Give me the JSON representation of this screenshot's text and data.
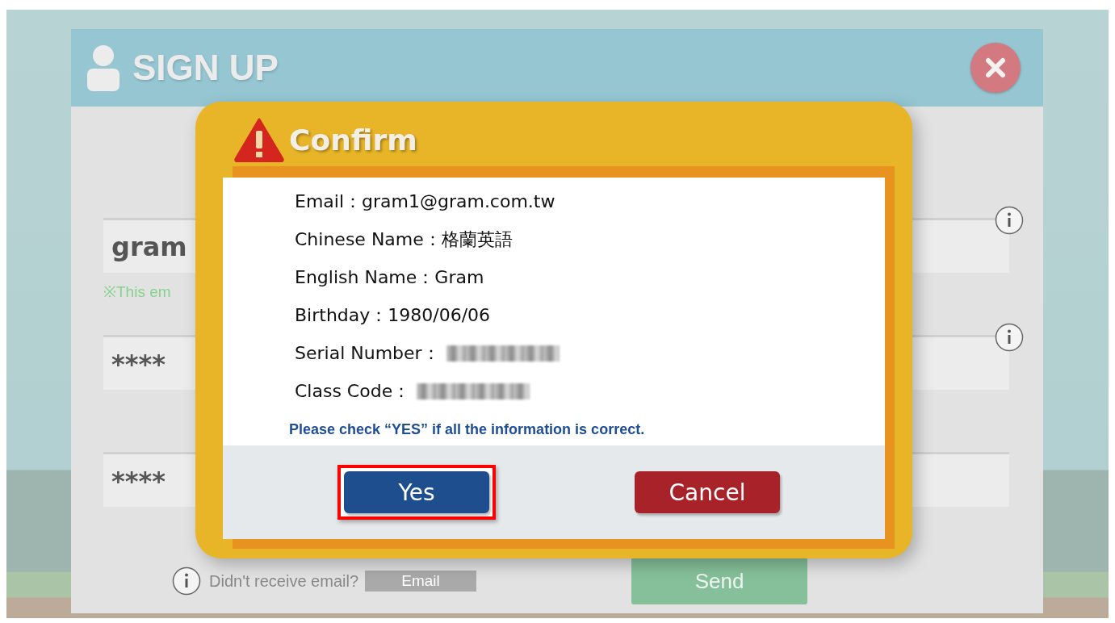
{
  "signup": {
    "title": "SIGN UP",
    "fields": [
      {
        "value": "gram",
        "note": "※This em",
        "info": true
      },
      {
        "value": "****",
        "info": true
      },
      {
        "value": "****",
        "info": false
      }
    ],
    "resend": {
      "label": "Didn't receive email?",
      "button": "Email"
    },
    "send_button": "Send"
  },
  "dialog": {
    "title": "Confirm",
    "rows": [
      {
        "label": "Email：",
        "value": "gram1@gram.com.tw",
        "redacted": false
      },
      {
        "label": "Chinese Name：",
        "value": "格蘭英語",
        "redacted": false
      },
      {
        "label": "English Name：",
        "value": "Gram",
        "redacted": false
      },
      {
        "label": "Birthday：",
        "value": "1980/06/06",
        "redacted": false
      },
      {
        "label": "Serial Number：",
        "redacted": true
      },
      {
        "label": "Class Code：",
        "redacted": true
      }
    ],
    "hint": "Please check “YES” if all the information is correct.",
    "buttons": [
      {
        "label": "Yes",
        "kind": "primary",
        "highlighted": true
      },
      {
        "label": "Cancel",
        "kind": "danger",
        "highlighted": false
      }
    ]
  }
}
